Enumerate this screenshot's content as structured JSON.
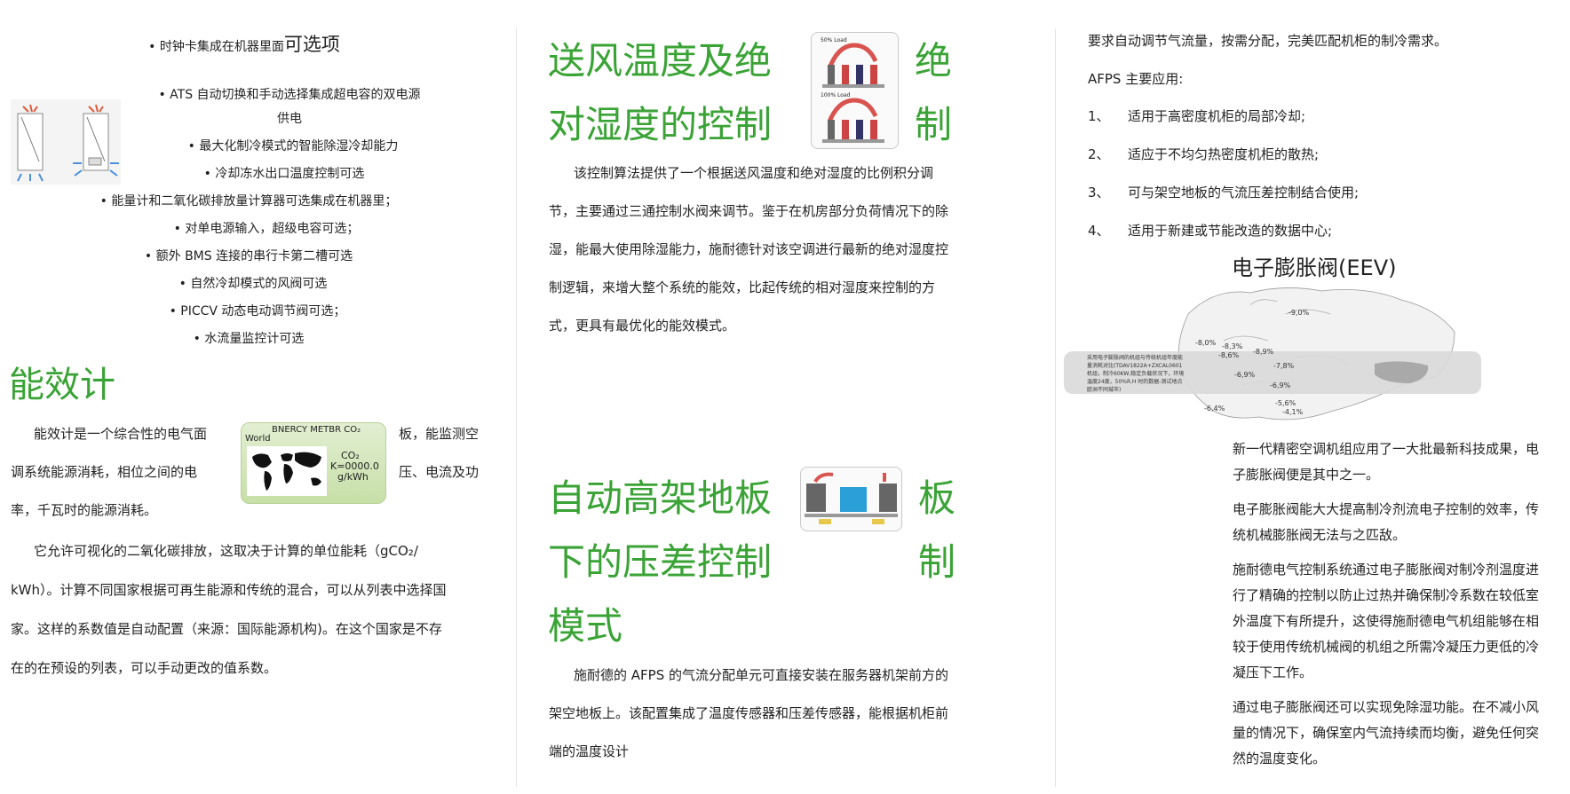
{
  "left": {
    "bullets": [
      "• 时钟卡集成在机器里面",
      "• ATS 自动切换和手动选择集成超电容的双电源",
      "供电",
      "• 最大化制冷模式的智能除湿冷却能力",
      "• 冷却冻水出口温度控制可选",
      "• 能量计和二氧化碳排放量计算器可选集成在机器里；",
      "• 对单电源输入，超级电容可选；",
      "• 额外 BMS 连接的串行卡第二槽可选",
      "• 自然冷却模式的风阀可选",
      "• PICCV 动态电动调节阀可选；",
      "• 水流量监控计可选"
    ],
    "bullet1_suffix": "可选项",
    "section_title": "能效计",
    "para1": [
      "能效计是一个综合性的电气面",
      "板，能监测空",
      "调系统能源消耗，相位之间的电",
      "压、电流及功",
      "率，千瓦时的能源消耗。"
    ],
    "para2": [
      "它允许可视化的二氧化碳排放，这取决于计算的单位能耗（gCO₂/",
      "kWh）。计算不同国家根据可再生能源和传统的混合，可以从列表中选择国",
      "家。这样的系数值是自动配置（来源：国际能源机构)。在这个国家是不存",
      "在的在预设的列表，可以手动更改的值系数。"
    ],
    "energy_card": {
      "title": "BNERCY METBR CO₂",
      "world": "World",
      "co2": "CO₂",
      "value": "K=0000.0",
      "unit": "g/kWh"
    }
  },
  "middle": {
    "title1": [
      "送风温度及绝",
      "对湿度的控制"
    ],
    "title1_right": [
      "绝",
      "制"
    ],
    "thumb1_labels": [
      "50% Load",
      "100% Load"
    ],
    "para1": [
      "该控制算法提供了一个根据送风温度和绝对湿度的比例积分调",
      "节，主要通过三通控制水阀来调节。鉴于在机房部分负荷情况下的除",
      "湿，能最大使用除湿能力，施耐德针对该空调进行最新的绝对湿度控",
      "制逻辑，来增大整个系统的能效，比起传统的相对湿度来控制的方",
      "式，更具有最优化的能效模式。"
    ],
    "title2": [
      "自动高架地板",
      "下的压差控制",
      "模式"
    ],
    "title2_right": [
      "板",
      "制"
    ],
    "para2": [
      "施耐德的 AFPS 的气流分配单元可直接安装在服务器机架前方的",
      "架空地板上。该配置集成了温度传感器和压差传感器，能根据机柜前",
      "端的温度设计"
    ]
  },
  "right": {
    "intro": "要求自动调节气流量，按需分配，完美匹配机柜的制冷需求。",
    "afps_title": "AFPS 主要应用:",
    "apps": [
      {
        "num": "1、",
        "text": "适用于高密度机柜的局部冷却;"
      },
      {
        "num": "2、",
        "text": "适应于不均匀热密度机柜的散热;"
      },
      {
        "num": "3、",
        "text": "可与架空地板的气流压差控制结合使用;"
      },
      {
        "num": "4、",
        "text": "适用于新建或节能改造的数据中心;"
      }
    ],
    "eev_title": "电子膨胀阀(EEV)",
    "map_note": [
      "采用电子膨胀阀的机组与传统机组年度能",
      "量消耗对比(TDAV1822A+ZXCAL0601",
      "机组，制冷60KW,稳定负载状况下，环境",
      "温度24度，50%R.H 时的数据-测试地点",
      "欧洲不同城市)"
    ],
    "map_labels": [
      "-9,0%",
      "-8,0%",
      "-8,3%",
      "-8,6%",
      "-8,9%",
      "-7,8%",
      "-6,9%",
      "-6,9%",
      "-5,6%",
      "-4,1%",
      "-6,4%"
    ],
    "paras": [
      [
        "新一代精密空调机组应用了一大批最新科技成果，电",
        "子膨胀阀便是其中之一。"
      ],
      [
        "电子膨胀阀能大大提高制冷剂流电子控制的效率，传",
        "统机械膨胀阀无法与之匹敌。"
      ],
      [
        "施耐德电气控制系统通过电子膨胀阀对制冷剂温度进",
        "行了精确的控制以防止过热并确保制冷系数在较低室",
        "外温度下有所提升，这使得施耐德电气机组能够在相",
        "较于使用传统机械阀的机组之所需冷凝压力更低的冷",
        "凝压下工作。"
      ],
      [
        "通过电子膨胀阀还可以实现免除湿功能。在不减小风",
        "量的情况下，确保室内气流持续而均衡，避免任何突",
        "然的温度变化。"
      ]
    ]
  },
  "colors": {
    "accent": "#3aa335",
    "text": "#222222",
    "divider": "#e3e3e3"
  }
}
